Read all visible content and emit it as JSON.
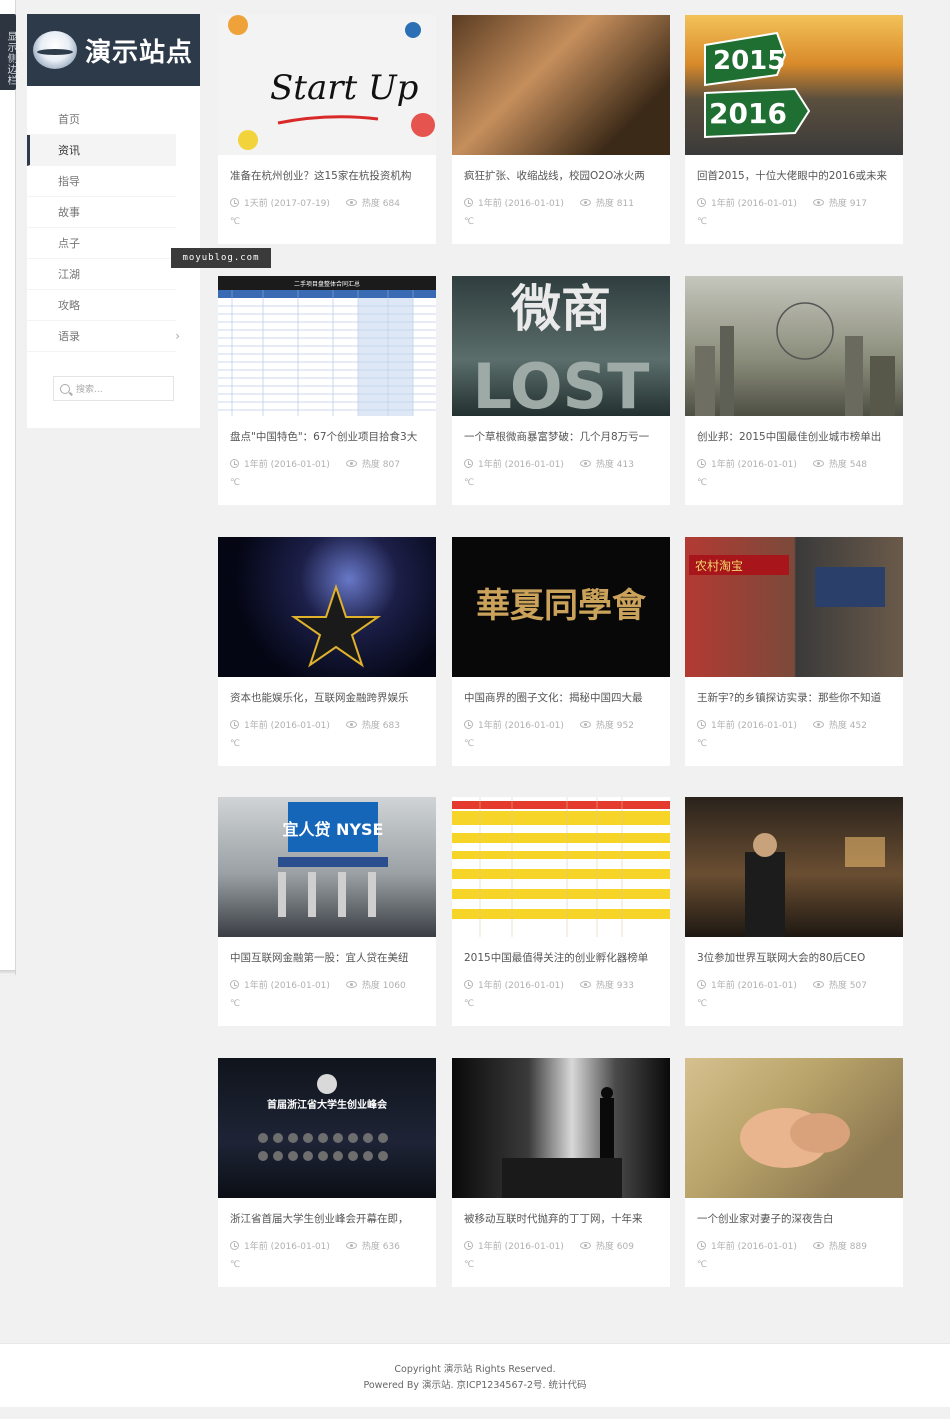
{
  "side_toggle": {
    "label": "显示侧边栏"
  },
  "sidebar": {
    "logo_text": "演示站点",
    "nav": [
      {
        "label": "首页",
        "active": false
      },
      {
        "label": "资讯",
        "active": true
      },
      {
        "label": "指导",
        "active": false
      },
      {
        "label": "故事",
        "active": false
      },
      {
        "label": "点子",
        "active": false
      },
      {
        "label": "江湖",
        "active": false
      },
      {
        "label": "攻略",
        "active": false
      },
      {
        "label": "语录",
        "active": false,
        "has_submenu": true
      }
    ],
    "search_placeholder": "搜索..."
  },
  "watermark": "moyublog.com",
  "cards": [
    {
      "title": "准备在杭州创业？这15家在杭投资机构",
      "time": "1天前 (2017-07-19)",
      "heat": "热度 684",
      "degree": "℃",
      "thumb_label": "Start Up"
    },
    {
      "title": "疯狂扩张、收缩战线，校园O2O冰火两",
      "time": "1年前 (2016-01-01)",
      "heat": "热度 811",
      "degree": "℃",
      "thumb_label": ""
    },
    {
      "title": "回首2015，十位大佬眼中的2016或未来",
      "time": "1年前 (2016-01-01)",
      "heat": "热度 917",
      "degree": "℃",
      "thumb_label": "2015 2016"
    },
    {
      "title": "盘点\"中国特色\"：67个创业项目拾食3大",
      "time": "1年前 (2016-01-01)",
      "heat": "热度 807",
      "degree": "℃",
      "thumb_label": "二手项目盘整体合同汇总"
    },
    {
      "title": "一个草根微商暴富梦破：几个月8万亏一",
      "time": "1年前 (2016-01-01)",
      "heat": "热度 413",
      "degree": "℃",
      "thumb_label": "微商 LOST"
    },
    {
      "title": "创业邦：2015中国最佳创业城市榜单出",
      "time": "1年前 (2016-01-01)",
      "heat": "热度 548",
      "degree": "℃",
      "thumb_label": ""
    },
    {
      "title": "资本也能娱乐化，互联网金融跨界娱乐",
      "time": "1年前 (2016-01-01)",
      "heat": "热度 683",
      "degree": "℃",
      "thumb_label": ""
    },
    {
      "title": "中国商界的圈子文化：揭秘中国四大最",
      "time": "1年前 (2016-01-01)",
      "heat": "热度 952",
      "degree": "℃",
      "thumb_label": "華夏同學會"
    },
    {
      "title": "王新宇?的乡镇探访实录：那些你不知道",
      "time": "1年前 (2016-01-01)",
      "heat": "热度 452",
      "degree": "℃",
      "thumb_label": "农村淘宝"
    },
    {
      "title": "中国互联网金融第一股：宜人贷在美纽",
      "time": "1年前 (2016-01-01)",
      "heat": "热度 1060",
      "degree": "℃",
      "thumb_label": "宜人贷 NYSE"
    },
    {
      "title": "2015中国最值得关注的创业孵化器榜单",
      "time": "1年前 (2016-01-01)",
      "heat": "热度 933",
      "degree": "℃",
      "thumb_label": ""
    },
    {
      "title": "3位参加世界互联网大会的80后CEO",
      "time": "1年前 (2016-01-01)",
      "heat": "热度 507",
      "degree": "℃",
      "thumb_label": ""
    },
    {
      "title": "浙江省首届大学生创业峰会开幕在即，",
      "time": "1年前 (2016-01-01)",
      "heat": "热度 636",
      "degree": "℃",
      "thumb_label": "首届浙江省大学生创业峰会"
    },
    {
      "title": "被移动互联时代抛弃的丁丁网，十年来",
      "time": "1年前 (2016-01-01)",
      "heat": "热度 609",
      "degree": "℃",
      "thumb_label": ""
    },
    {
      "title": "一个创业家对妻子的深夜告白",
      "time": "1年前 (2016-01-01)",
      "heat": "热度 889",
      "degree": "℃",
      "thumb_label": ""
    }
  ],
  "footer": {
    "line1": "Copyright 演示站 Rights Reserved.",
    "line2": "Powered By 演示站. 京ICP1234567-2号. 统计代码"
  }
}
